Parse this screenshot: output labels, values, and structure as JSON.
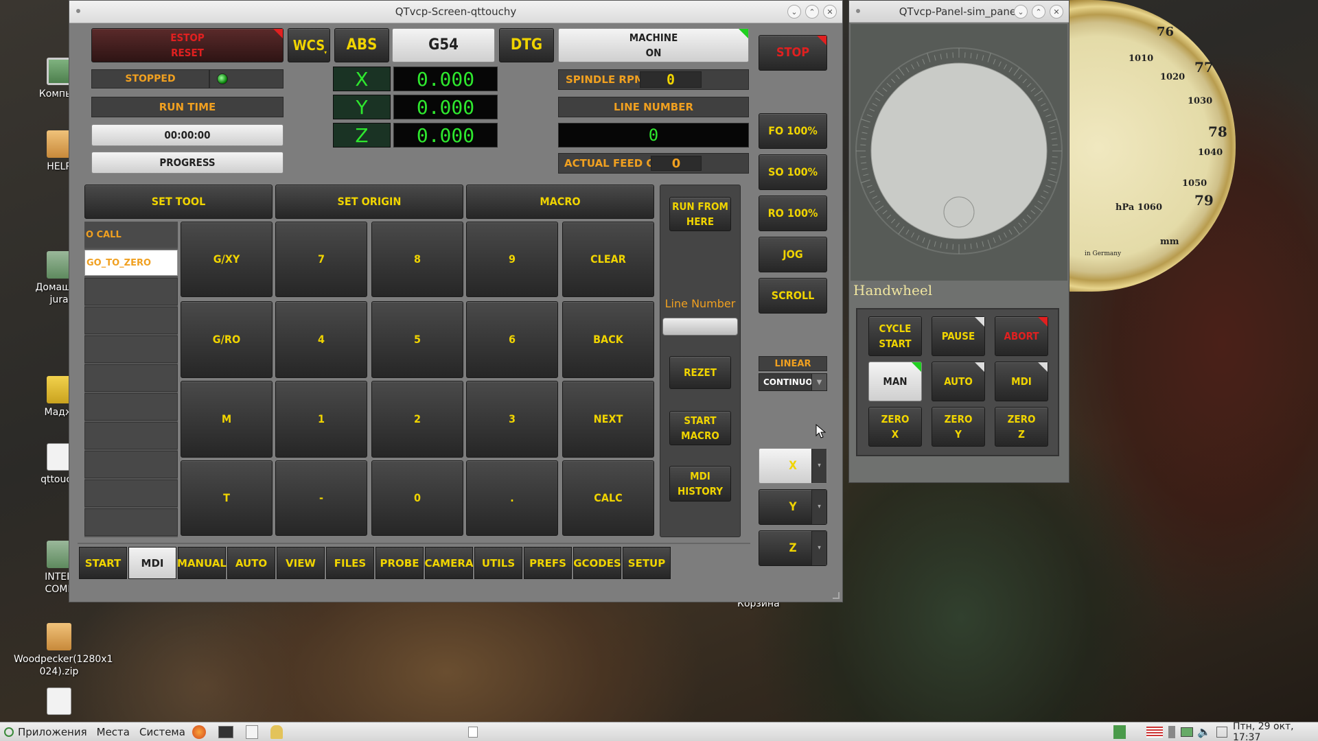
{
  "desktop": {
    "icons": [
      {
        "name": "computer",
        "label": "Компью"
      },
      {
        "name": "help",
        "label": "HELP"
      },
      {
        "name": "home",
        "label": "Домашня\njura"
      },
      {
        "name": "magic",
        "label": "Мадж"
      },
      {
        "name": "qttouchy",
        "label": "qttouch"
      },
      {
        "name": "interface",
        "label": "INTER\nCOMF"
      },
      {
        "name": "woodpecker",
        "label": "Woodpecker(1280x1\n024).zip"
      },
      {
        "name": "file",
        "label": ""
      }
    ],
    "trash_label": "Корзина",
    "barometer": {
      "labels": [
        "76",
        "1010",
        "1020",
        "77",
        "1030",
        "78",
        "1040",
        "1050",
        "hPa 1060",
        "79",
        "mm",
        "in Germany"
      ]
    }
  },
  "main_window": {
    "title": "QTvcp-Screen-qttouchy",
    "estop_button": {
      "label": "ESTOP\nRESET",
      "corner_color": "#e02020"
    },
    "wcs_button": "WCS",
    "abs_button": "ABS",
    "g54_label": "G54",
    "dtg_button": "DTG",
    "machine_button": {
      "label": "MACHINE\nON",
      "corner_color": "#20d020"
    },
    "stop_button": "STOP",
    "status_label": "STOPPED",
    "run_time_label": "RUN TIME",
    "run_time_value": "00:00:00",
    "progress_label": "PROGRESS",
    "axes": [
      {
        "name": "X",
        "value": "0.000"
      },
      {
        "name": "Y",
        "value": "0.000"
      },
      {
        "name": "Z",
        "value": "0.000"
      }
    ],
    "spindle_rpm_label": "SPINDLE RPM",
    "spindle_rpm_value": "0",
    "line_number_label": "LINE NUMBER",
    "line_number_value": "0",
    "actual_feed_label": "ACTUAL FEED OVR.",
    "actual_feed_value": "0",
    "overrides": [
      "FO 100%",
      "SO 100%",
      "RO 100%"
    ],
    "jog_button": "JOG",
    "scroll_button": "SCROLL",
    "linear_label": "LINEAR",
    "continuous_select": "CONTINUOUS",
    "axis_selectors": [
      "X",
      "Y",
      "Z"
    ],
    "tool_tabs": [
      "SET TOOL",
      "SET ORIGIN",
      "MACRO"
    ],
    "macro_list": [
      "O CALL",
      "GO_TO_ZERO"
    ],
    "keypad": [
      [
        "G/XY",
        "7",
        "8",
        "9",
        "CLEAR"
      ],
      [
        "G/RO",
        "4",
        "5",
        "6",
        "BACK"
      ],
      [
        "M",
        "1",
        "2",
        "3",
        "NEXT"
      ],
      [
        "T",
        "-",
        "0",
        ".",
        "CALC"
      ]
    ],
    "run_from_here": "RUN FROM\nHERE",
    "line_number_field_label": "Line Number",
    "rezet_button": "REZET",
    "start_macro_button": "START\nMACRO",
    "mdi_history_button": "MDI\nHISTORY",
    "bottom_tabs": [
      "START",
      "MDI",
      "MANUAL",
      "AUTO",
      "VIEW",
      "FILES",
      "PROBE",
      "CAMERA",
      "UTILS",
      "PREFS",
      "GCODES",
      "SETUP"
    ],
    "selected_tab": "MDI"
  },
  "panel_window": {
    "title": "QTvcp-Panel-sim_panel",
    "handwheel_label": "Handwheel",
    "buttons": [
      [
        "CYCLE\nSTART",
        "PAUSE",
        "ABORT"
      ],
      [
        "MAN",
        "AUTO",
        "MDI"
      ],
      [
        "ZERO\nX",
        "ZERO\nY",
        "ZERO\nZ"
      ]
    ]
  },
  "taskbar": {
    "menu_items": [
      "Приложения",
      "Места",
      "Система"
    ],
    "datetime": "Птн, 29 окт, 17:37"
  },
  "colors": {
    "accent_yellow": "#f0d400",
    "label_orange": "#f0a020",
    "dro_green": "#2ee82e",
    "alarm_red": "#e02020"
  }
}
